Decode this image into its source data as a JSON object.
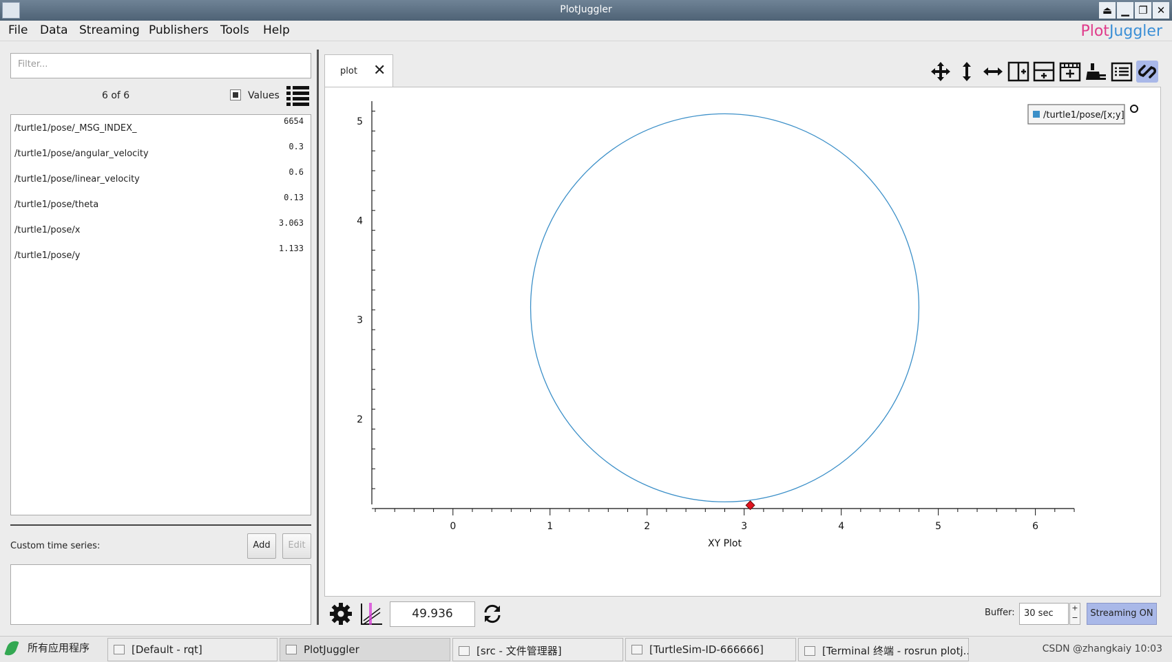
{
  "window": {
    "title": "PlotJuggler"
  },
  "menu": [
    "File",
    "Data",
    "Streaming",
    "Publishers",
    "Tools",
    "Help"
  ],
  "brand": {
    "part1": "Plot",
    "part2": "Juggler",
    "color1": "#e03a8a",
    "color2": "#3b8fd6"
  },
  "left": {
    "filter_placeholder": "Filter...",
    "count": "6 of 6",
    "values_label": "Values",
    "values_checked": true,
    "timeseries": [
      {
        "name": "/turtle1/pose/_MSG_INDEX_",
        "value": "6654"
      },
      {
        "name": "/turtle1/pose/angular_velocity",
        "value": "0.3"
      },
      {
        "name": "/turtle1/pose/linear_velocity",
        "value": "0.6"
      },
      {
        "name": "/turtle1/pose/theta",
        "value": "0.13"
      },
      {
        "name": "/turtle1/pose/x",
        "value": "3.063"
      },
      {
        "name": "/turtle1/pose/y",
        "value": "1.133"
      }
    ],
    "custom_label": "Custom time series:",
    "add_label": "Add",
    "edit_label": "Edit"
  },
  "plot_tab": {
    "label": "plot"
  },
  "toolbar": [
    "move-icon",
    "zoom-vertical-icon",
    "zoom-horizontal-icon",
    "split-horizontal-icon",
    "split-vertical-icon",
    "add-tab-icon",
    "clear-icon",
    "legend-icon",
    "link-icon"
  ],
  "chart_data": {
    "type": "scatter",
    "xlabel": "XY Plot",
    "ylabel": "",
    "xlim": [
      -0.8,
      6.4
    ],
    "ylim": [
      1.1,
      5.2
    ],
    "xticks": [
      0,
      1,
      2,
      3,
      4,
      5,
      6
    ],
    "yticks": [
      2,
      3,
      4,
      5
    ],
    "series": [
      {
        "name": "/turtle1/pose/[x;y]",
        "color": "#3b8fc8",
        "shape": "circle",
        "center": [
          2.8,
          3.12
        ],
        "radius": 2.0
      }
    ],
    "current_point": [
      3.063,
      1.133
    ],
    "current_point_color": "#e0141e",
    "legend": "top-right"
  },
  "bottom": {
    "time_value": "49.936",
    "buffer_label": "Buffer:",
    "buffer_value": "30 sec",
    "streaming_label": "Streaming ON",
    "streaming_color": "#a9b8e8"
  },
  "taskbar": {
    "start_label": "所有应用程序",
    "tasks": [
      "[Default - rqt]",
      "PlotJuggler",
      "[src - 文件管理器]",
      "[TurtleSim-ID-666666]",
      "[Terminal 终端 - rosrun plotj..."
    ],
    "tray_text": "CSDN @zhangkaiy  10:03"
  }
}
